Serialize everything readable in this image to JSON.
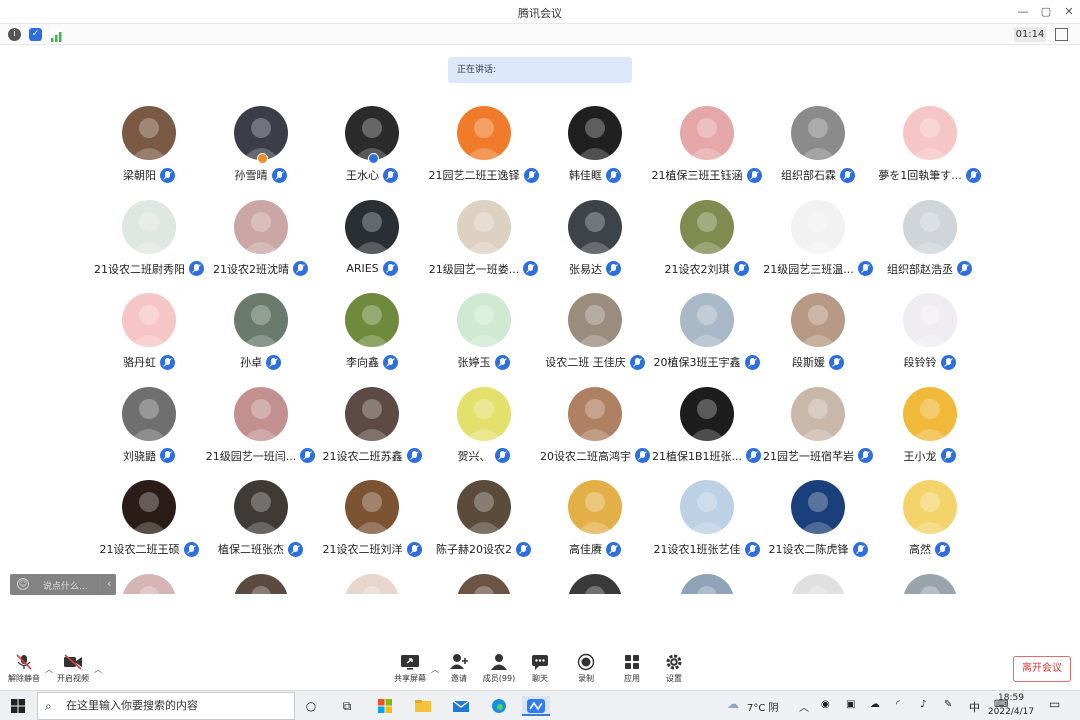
{
  "window": {
    "title": "腾讯会议",
    "minimize": "—",
    "maximize": "▢",
    "close": "✕"
  },
  "status": {
    "info_icon": "info-icon",
    "shield_icon": "shield-icon",
    "signal_icon": "signal-icon",
    "timer": "01:14"
  },
  "speaking": {
    "label": "正在讲话:"
  },
  "participants": [
    {
      "name": "梁朝阳",
      "bg": "#7a5a44"
    },
    {
      "name": "孙雪晴",
      "bg": "#3b3e48",
      "badge": "#f08a24"
    },
    {
      "name": "王水心",
      "bg": "#2b2b2b",
      "badge": "#2e6fe0"
    },
    {
      "name": "21园艺二班王逸铎",
      "bg": "#f07b2a"
    },
    {
      "name": "韩佳眶",
      "bg": "#202020"
    },
    {
      "name": "21植保三班王钰涵",
      "bg": "#e6a7a9"
    },
    {
      "name": "组织部石霖",
      "bg": "#8b8b8b"
    },
    {
      "name": "夢を1回執筆す...",
      "bg": "#f6c6c6"
    },
    {
      "name": "21设农二班尉秀阳",
      "bg": "#dfe7e2"
    },
    {
      "name": "21设农2班沈晴",
      "bg": "#caa7a5"
    },
    {
      "name": "ARIES",
      "bg": "#2a2f33"
    },
    {
      "name": "21级园艺一班娄...",
      "bg": "#ddd1c1"
    },
    {
      "name": "张易达",
      "bg": "#3e4349"
    },
    {
      "name": "21设农2刘琪",
      "bg": "#7f8b4f"
    },
    {
      "name": "21级园艺三班温...",
      "bg": "#f2f2f2"
    },
    {
      "name": "组织部赵浩丞",
      "bg": "#cfd5d8"
    },
    {
      "name": "骆丹虹",
      "bg": "#f6c6c6"
    },
    {
      "name": "孙卓",
      "bg": "#6a7a6d"
    },
    {
      "name": "李向鑫",
      "bg": "#6f8a3c"
    },
    {
      "name": "张婷玉",
      "bg": "#cfead2"
    },
    {
      "name": "设农二班 王佳庆",
      "bg": "#9a8d7d"
    },
    {
      "name": "20植保3班王宇鑫",
      "bg": "#a9b9c8"
    },
    {
      "name": "段斯媛",
      "bg": "#b79a86"
    },
    {
      "name": "段铃铃",
      "bg": "#efedf2"
    },
    {
      "name": "刘骁鼯",
      "bg": "#6f6f6f"
    },
    {
      "name": "21级园艺一班闫...",
      "bg": "#c2908f"
    },
    {
      "name": "21设农二班苏鑫",
      "bg": "#5e4a44"
    },
    {
      "name": "贺兴、",
      "bg": "#e4e06c"
    },
    {
      "name": "20设农二班高鸿宇",
      "bg": "#b08062"
    },
    {
      "name": "21植保1B1班张...",
      "bg": "#1d1d1d"
    },
    {
      "name": "21园艺一班宿芊岩",
      "bg": "#c9b8aa"
    },
    {
      "name": "王小龙",
      "bg": "#f0b93a"
    },
    {
      "name": "21设农二班王硕",
      "bg": "#2a1d18"
    },
    {
      "name": "植保二班张杰",
      "bg": "#3f3a36"
    },
    {
      "name": "21设农二班刘洋",
      "bg": "#7c5434"
    },
    {
      "name": "陈子赫20设农2",
      "bg": "#5a4b3b"
    },
    {
      "name": "高佳赓",
      "bg": "#e3b048"
    },
    {
      "name": "21设农1班张艺佳",
      "bg": "#bcd0e6"
    },
    {
      "name": "21设农二陈虎锋",
      "bg": "#1b3f7a"
    },
    {
      "name": "高然",
      "bg": "#f4d46a"
    },
    {
      "name": "",
      "bg": "#d6b5b5"
    },
    {
      "name": "",
      "bg": "#5b4a3f"
    },
    {
      "name": "",
      "bg": "#e6d6cc"
    },
    {
      "name": "",
      "bg": "#6b5444"
    },
    {
      "name": "",
      "bg": "#3a3a3a"
    },
    {
      "name": "",
      "bg": "#8ea3b8"
    },
    {
      "name": "",
      "bg": "#e0e0e0"
    },
    {
      "name": "",
      "bg": "#9aa4ad"
    }
  ],
  "chat": {
    "placeholder": "说点什么...",
    "emoji_icon": "emoji-icon",
    "collapse": "‹"
  },
  "toolbar": {
    "unmute": "解除静音",
    "start_video": "开启视频",
    "share_screen": "共享屏幕",
    "invite": "邀请",
    "members": "成员(99)",
    "chat": "聊天",
    "record": "录制",
    "apps": "应用",
    "settings": "设置",
    "leave": "离开会议"
  },
  "taskbar": {
    "search_placeholder": "在这里输入你要搜索的内容",
    "weather": "7°C 阴",
    "ime": "中",
    "time": "18:59",
    "date": "2022/4/17"
  }
}
